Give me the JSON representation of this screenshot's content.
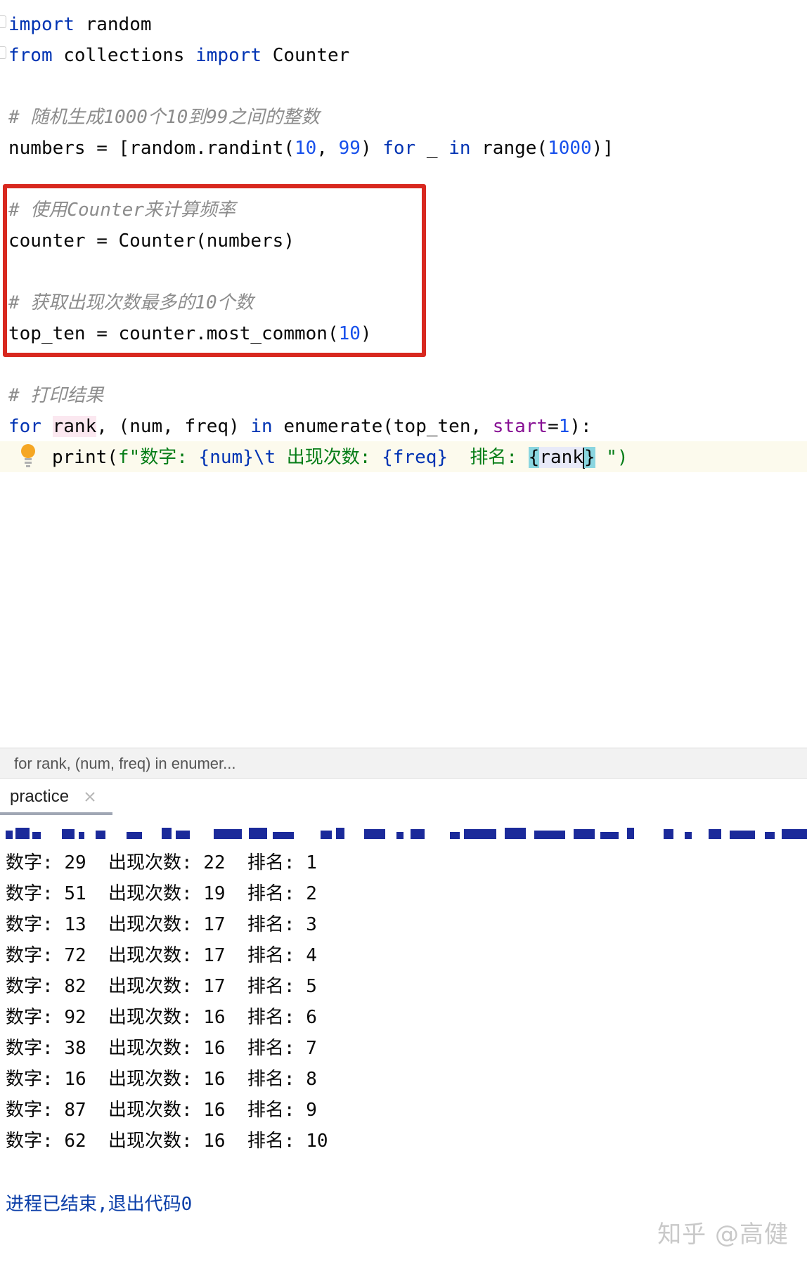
{
  "editor": {
    "lines": [
      {
        "id": "l1",
        "tokens": [
          [
            "kw",
            "import"
          ],
          [
            "",
            "&nbsp;random"
          ]
        ]
      },
      {
        "id": "l2",
        "tokens": [
          [
            "kw",
            "from"
          ],
          [
            "",
            " collections "
          ],
          [
            "kw",
            "import"
          ],
          [
            "",
            " Counter"
          ]
        ]
      }
    ],
    "code": {
      "import_kw": "import",
      "import_mod": " random",
      "from_kw": "from",
      "from_mod": " collections ",
      "import_kw2": "import",
      "counter_cls": " Counter",
      "comment1": "# 随机生成1000个10到99之间的整数",
      "numbers_lhs": "numbers = [random.randint(",
      "n10": "10",
      "comma": ", ",
      "n99": "99",
      "paren_close": ") ",
      "for_kw": "for",
      "underscore": " _ ",
      "in_kw": "in",
      "range_fn": " range(",
      "n1000": "1000",
      "list_close": ")]",
      "comment2": "# 使用Counter来计算频率",
      "counter_line": "counter = Counter(numbers)",
      "comment3": "# 获取出现次数最多的10个数",
      "top_ten_lhs": "top_ten = counter.most_common(",
      "n10b": "10",
      "top_ten_rhs": ")",
      "comment4": "# 打印结果",
      "for_kw2": "for",
      "space1": " ",
      "rank_var": "rank",
      "for_mid": ", (num, freq) ",
      "in_kw2": "in",
      "enum_call": " enumerate(top_ten, ",
      "start_param": "start",
      "eq": "=",
      "n1": "1",
      "for_end": "):",
      "print_fn": "print(",
      "fstr_start": "f\"数字: ",
      "num_expr": "{num}",
      "tab_esc": "\\t",
      "fstr_mid": " 出现次数: ",
      "freq_expr": "{freq}",
      "fstr_mid2": "  排名: ",
      "brace_open": "{",
      "rank_expr": "rank",
      "brace_close": "}",
      "fstr_end": " \")"
    }
  },
  "breadcrumb": {
    "text": "for rank, (num, freq) in enumer..."
  },
  "run_panel": {
    "tab_label": "practice",
    "output": [
      {
        "num": "29",
        "freq": "22",
        "rank": "1"
      },
      {
        "num": "51",
        "freq": "19",
        "rank": "2"
      },
      {
        "num": "13",
        "freq": "17",
        "rank": "3"
      },
      {
        "num": "72",
        "freq": "17",
        "rank": "4"
      },
      {
        "num": "82",
        "freq": "17",
        "rank": "5"
      },
      {
        "num": "92",
        "freq": "16",
        "rank": "6"
      },
      {
        "num": "38",
        "freq": "16",
        "rank": "7"
      },
      {
        "num": "16",
        "freq": "16",
        "rank": "8"
      },
      {
        "num": "87",
        "freq": "16",
        "rank": "9"
      },
      {
        "num": "62",
        "freq": "16",
        "rank": "10"
      }
    ],
    "labels": {
      "num": "数字: ",
      "freq": "出现次数: ",
      "rank": "排名: "
    },
    "exit_message": "进程已结束,退出代码0"
  },
  "watermark": "知乎 @高健",
  "colors": {
    "highlight_box": "#d8281f",
    "keyword": "#0033b3",
    "number": "#1750eb",
    "string": "#067d17"
  }
}
